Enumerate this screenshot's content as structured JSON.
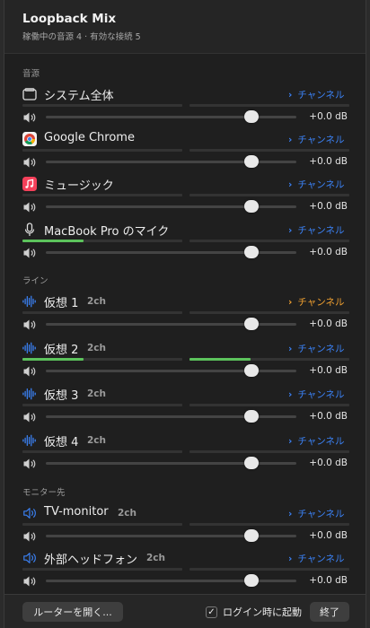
{
  "app": {
    "title": "Loopback Mix",
    "subtitle": "稼働中の音源 4 · 有効な接続 5"
  },
  "sections": {
    "sources": "音源",
    "lines": "ライン",
    "monitors": "モニター先"
  },
  "channel_label": "チャンネル",
  "rows": [
    {
      "name": "システム全体",
      "ch": "",
      "icon": "window-icon",
      "volume": "+0.0 dB",
      "level": 0.84,
      "meter_left": 0,
      "meter_right": 0
    },
    {
      "name": "Google Chrome",
      "ch": "",
      "icon": "chrome-icon",
      "volume": "+0.0 dB",
      "level": 0.84,
      "meter_left": 0,
      "meter_right": 0
    },
    {
      "name": "ミュージック",
      "ch": "",
      "icon": "music-app-icon",
      "volume": "+0.0 dB",
      "level": 0.84,
      "meter_left": 0,
      "meter_right": 0
    },
    {
      "name": "MacBook Pro のマイク",
      "ch": "",
      "icon": "microphone-icon",
      "volume": "+0.0 dB",
      "level": 0.84,
      "meter_left": 0.38,
      "meter_right": 0
    },
    {
      "name": "仮想 1",
      "ch": "2ch",
      "icon": "waveform-icon",
      "volume": "+0.0 dB",
      "level": 0.84,
      "meter_left": 0,
      "meter_right": 0,
      "active": true
    },
    {
      "name": "仮想 2",
      "ch": "2ch",
      "icon": "waveform-icon",
      "volume": "+0.0 dB",
      "level": 0.84,
      "meter_left": 0.38,
      "meter_right": 0.38
    },
    {
      "name": "仮想 3",
      "ch": "2ch",
      "icon": "waveform-icon",
      "volume": "+0.0 dB",
      "level": 0.84,
      "meter_left": 0,
      "meter_right": 0
    },
    {
      "name": "仮想 4",
      "ch": "2ch",
      "icon": "waveform-icon",
      "volume": "+0.0 dB",
      "level": 0.84,
      "meter_left": 0,
      "meter_right": 0
    },
    {
      "name": "TV-monitor",
      "ch": "2ch",
      "icon": "speaker-icon",
      "volume": "+0.0 dB",
      "level": 0.84,
      "meter_left": 0,
      "meter_right": 0
    },
    {
      "name": "外部ヘッドフォン",
      "ch": "2ch",
      "icon": "speaker-icon",
      "volume": "+0.0 dB",
      "level": 0.84,
      "meter_left": 0,
      "meter_right": 0
    }
  ],
  "footer": {
    "open_router": "ルーターを開く...",
    "login_launch": "ログイン時に起動",
    "login_checked": true,
    "quit": "終了"
  },
  "colors": {
    "accent": "#3b82f6",
    "active_channel": "#f0a030",
    "meter_green": "#5cc35c"
  }
}
